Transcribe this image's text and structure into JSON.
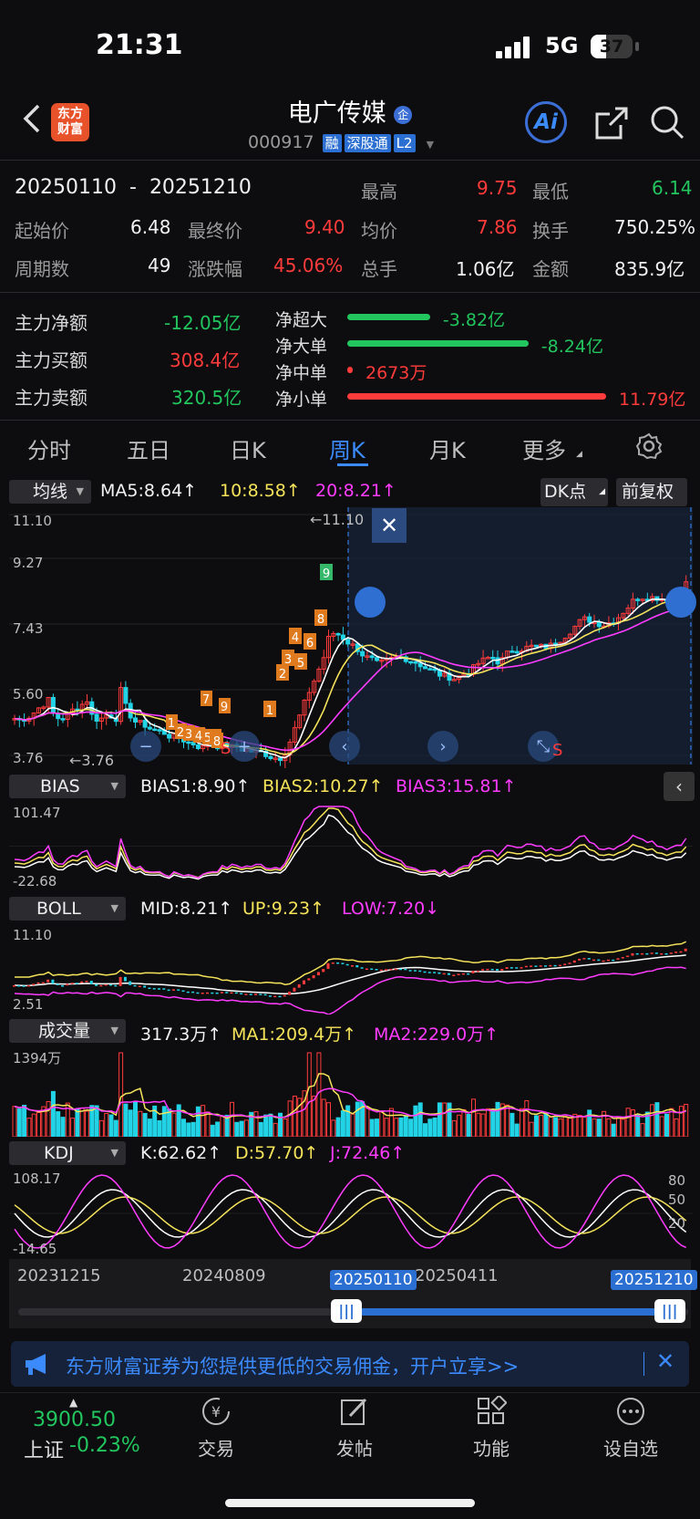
{
  "status": {
    "time": "21:31",
    "network": "5G",
    "battery": "37"
  },
  "header": {
    "back_icon": "chevron-left-icon",
    "logo_line1": "东方",
    "logo_line2": "财富",
    "name": "电广传媒",
    "name_badge": "企",
    "code": "000917",
    "tags": [
      "融",
      "深股通",
      "L2"
    ],
    "ai_label": "Ai",
    "share_icon": "share-icon",
    "search_icon": "search-icon"
  },
  "summary": {
    "date_start": "20250110",
    "date_sep": "-",
    "date_end": "20251210",
    "high_label": "最高",
    "high_value": "9.75",
    "low_label": "最低",
    "low_value": "6.14",
    "open_label": "起始价",
    "open_value": "6.48",
    "close_label": "最终价",
    "close_value": "9.40",
    "avg_label": "均价",
    "avg_value": "7.86",
    "turnover_label": "换手",
    "turnover_value": "750.25%",
    "periods_label": "周期数",
    "periods_value": "49",
    "change_label": "涨跌幅",
    "change_value": "45.06%",
    "volume_label": "总手",
    "volume_value": "1.06亿",
    "amount_label": "金额",
    "amount_value": "835.9亿"
  },
  "flows": {
    "net_label": "主力净额",
    "net_value": "-12.05亿",
    "buy_label": "主力买额",
    "buy_value": "308.4亿",
    "sell_label": "主力卖额",
    "sell_value": "320.5亿",
    "bars": [
      {
        "label": "净超大",
        "value": "-3.82亿",
        "fraction": 0.16,
        "color": "#22c55e"
      },
      {
        "label": "净大单",
        "value": "-8.24亿",
        "fraction": 0.35,
        "color": "#22c55e"
      },
      {
        "label": "净中单",
        "value": "2673万",
        "fraction": 0.0,
        "color": "#ff3b3b"
      },
      {
        "label": "净小单",
        "value": "11.79亿",
        "fraction": 0.5,
        "color": "#ff3b3b"
      }
    ]
  },
  "tabs": {
    "items": [
      "分时",
      "五日",
      "日K",
      "周K",
      "月K",
      "更多"
    ],
    "active_index": 3,
    "settings_icon": "gear-icon"
  },
  "main_chart": {
    "indicator_select": "均线",
    "ma5": "MA5:8.64↑",
    "ma10": "10:8.58↑",
    "ma20": "20:8.21↑",
    "dk_button": "DK点",
    "adjust_button": "前复权",
    "y_top": "11.10",
    "y_2": "9.27",
    "y_3": "7.43",
    "y_4": "5.60",
    "y_bottom": "3.76",
    "max_marker": "←11.10",
    "min_marker": "←3.76",
    "close_icon": "close-icon",
    "nine_turn_sell": [
      "1",
      "2",
      "3",
      "4",
      "5",
      "6",
      "7",
      "8",
      "9"
    ],
    "nine_turn_label_9": "9",
    "signal_s": "S"
  },
  "bias": {
    "label": "BIAS",
    "b1": "BIAS1:8.90↑",
    "b2": "BIAS2:10.27↑",
    "b3": "BIAS3:15.81↑",
    "y_top": "101.47",
    "y_bottom": "-22.68"
  },
  "boll": {
    "label": "BOLL",
    "mid": "MID:8.21↑",
    "up": "UP:9.23↑",
    "low": "LOW:7.20↓",
    "y_top": "11.10",
    "y_bottom": "2.51"
  },
  "volume": {
    "label": "成交量",
    "v": "317.3万↑",
    "ma1": "MA1:209.4万↑",
    "ma2": "MA2:229.0万↑",
    "y_top": "1394万"
  },
  "kdj": {
    "label": "KDJ",
    "k": "K:62.62↑",
    "d": "D:57.70↑",
    "j": "J:72.46↑",
    "y_top": "108.17",
    "y_bottom": "-14.65",
    "r80": "80",
    "r50": "50",
    "r20": "20"
  },
  "timeline": {
    "d1": "20231215",
    "d2": "20240809",
    "d3": "20250411",
    "sel_start": "20250110",
    "sel_end": "20251210",
    "start_fraction": 0.49,
    "end_fraction": 0.99
  },
  "ad": {
    "text": "东方财富证券为您提供更低的交易佣金，开户立享>>",
    "icon": "megaphone-icon",
    "close_icon": "close-icon"
  },
  "bottom_nav": {
    "index_value": "3900.50",
    "index_name": "上证",
    "index_change": "-0.23%",
    "items": [
      {
        "label": "交易",
        "icon": "yen-icon"
      },
      {
        "label": "发帖",
        "icon": "edit-icon"
      },
      {
        "label": "功能",
        "icon": "grid-icon"
      },
      {
        "label": "设自选",
        "icon": "more-icon"
      }
    ]
  },
  "colors": {
    "up": "#ff3b3b",
    "down": "#22d3e6",
    "ma5": "#ffffff",
    "ma10": "#f5e35a",
    "ma20": "#ff3cff",
    "accent": "#2a6fd1"
  }
}
